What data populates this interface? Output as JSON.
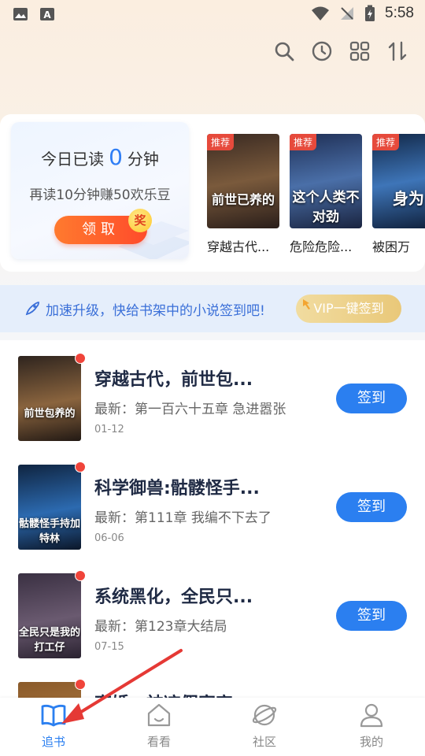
{
  "status_bar": {
    "time": "5:58"
  },
  "reading_card": {
    "prefix": "今日已读",
    "minutes": "0",
    "suffix": "分钟",
    "reward_text": "再读10分钟赚50欢乐豆",
    "claim_label": "领取",
    "badge": "奖"
  },
  "recommended": {
    "tag": "推荐",
    "books": [
      {
        "title": "穿越古代...",
        "cover_text": "前世已养的"
      },
      {
        "title": "危险危险...",
        "cover_text": "这个人类不对劲"
      },
      {
        "title": "被困万",
        "cover_text": "身为"
      }
    ]
  },
  "banner": {
    "text": "加速升级，快给书架中的小说签到吧!",
    "vip_button": "VIP一键签到"
  },
  "shelf": {
    "latest_prefix": "最新：",
    "sign_label": "签到",
    "books": [
      {
        "title": "穿越古代，前世包...",
        "latest": "最新：第一百六十五章 急进嚣张",
        "date": "01-12",
        "cover_text": "前世包养的"
      },
      {
        "title": "科学御兽:骷髅怪手...",
        "latest": "最新：第111章 我编不下去了",
        "date": "06-06",
        "cover_text": "骷髅怪手持加特林"
      },
      {
        "title": "系统黑化，全民只...",
        "latest": "最新：第123章大结局",
        "date": "07-15",
        "cover_text": "全民只是我的打工仔"
      },
      {
        "title": "离婚：神凉假家宣",
        "latest": "",
        "date": "",
        "cover_text": ""
      }
    ]
  },
  "bottom_nav": [
    {
      "label": "追书",
      "active": true
    },
    {
      "label": "看看",
      "active": false
    },
    {
      "label": "社区",
      "active": false
    },
    {
      "label": "我的",
      "active": false
    }
  ],
  "colors": {
    "accent": "#2b7ff0",
    "claim": "#ff5a2c",
    "arrow": "#e53935"
  }
}
